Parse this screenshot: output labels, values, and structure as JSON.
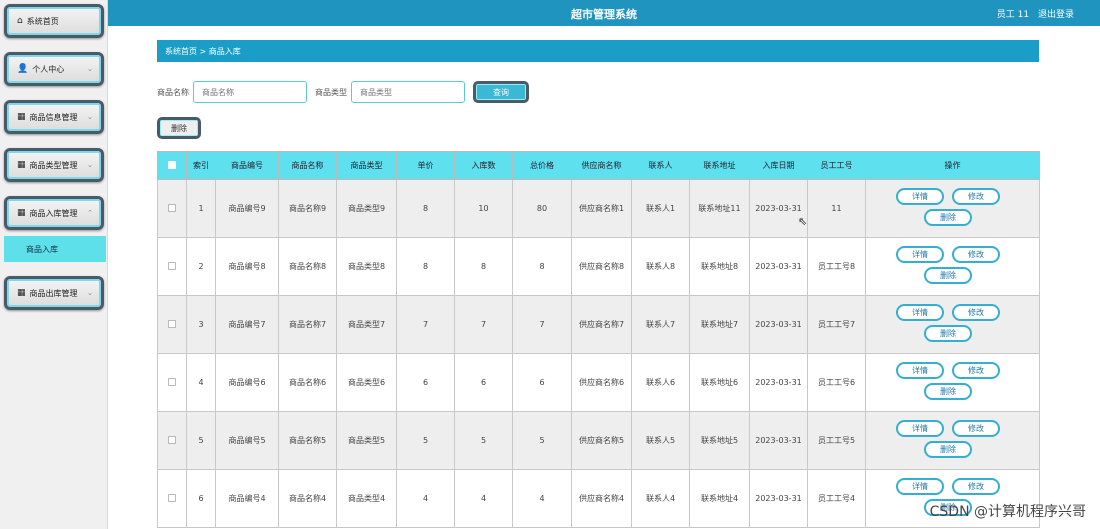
{
  "header": {
    "title": "超市管理系统",
    "user": "员工 11",
    "logout": "退出登录"
  },
  "sidebar": {
    "items": [
      {
        "icon": "⌂",
        "label": "系统首页"
      },
      {
        "icon": "👤",
        "label": "个人中心"
      },
      {
        "icon": "▦",
        "label": "商品信息管理"
      },
      {
        "icon": "▦",
        "label": "商品类型管理"
      },
      {
        "icon": "▦",
        "label": "商品入库管理"
      },
      {
        "icon": "▦",
        "label": "商品出库管理"
      }
    ],
    "submenu": "商品入库"
  },
  "breadcrumb": "系统首页 > 商品入库",
  "search": {
    "name_label": "商品名称",
    "name_placeholder": "商品名称",
    "type_label": "商品类型",
    "type_placeholder": "商品类型",
    "button": "查询"
  },
  "delete_all": "删除",
  "table": {
    "headers": [
      "",
      "索引",
      "商品编号",
      "商品名称",
      "商品类型",
      "单价",
      "入库数",
      "总价格",
      "供应商名称",
      "联系人",
      "联系地址",
      "入库日期",
      "员工工号",
      "操作"
    ],
    "actions": {
      "detail": "详情",
      "edit": "修改",
      "delete": "删除"
    },
    "rows": [
      [
        "1",
        "商品编号9",
        "商品名称9",
        "商品类型9",
        "8",
        "10",
        "80",
        "供应商名称1",
        "联系人1",
        "联系地址11",
        "2023-03-31",
        "11"
      ],
      [
        "2",
        "商品编号8",
        "商品名称8",
        "商品类型8",
        "8",
        "8",
        "8",
        "供应商名称8",
        "联系人8",
        "联系地址8",
        "2023-03-31",
        "员工工号8"
      ],
      [
        "3",
        "商品编号7",
        "商品名称7",
        "商品类型7",
        "7",
        "7",
        "7",
        "供应商名称7",
        "联系人7",
        "联系地址7",
        "2023-03-31",
        "员工工号7"
      ],
      [
        "4",
        "商品编号6",
        "商品名称6",
        "商品类型6",
        "6",
        "6",
        "6",
        "供应商名称6",
        "联系人6",
        "联系地址6",
        "2023-03-31",
        "员工工号6"
      ],
      [
        "5",
        "商品编号5",
        "商品名称5",
        "商品类型5",
        "5",
        "5",
        "5",
        "供应商名称5",
        "联系人5",
        "联系地址5",
        "2023-03-31",
        "员工工号5"
      ],
      [
        "6",
        "商品编号4",
        "商品名称4",
        "商品类型4",
        "4",
        "4",
        "4",
        "供应商名称4",
        "联系人4",
        "联系地址4",
        "2023-03-31",
        "员工工号4"
      ]
    ]
  },
  "watermark": "CSDN @计算机程序兴哥"
}
